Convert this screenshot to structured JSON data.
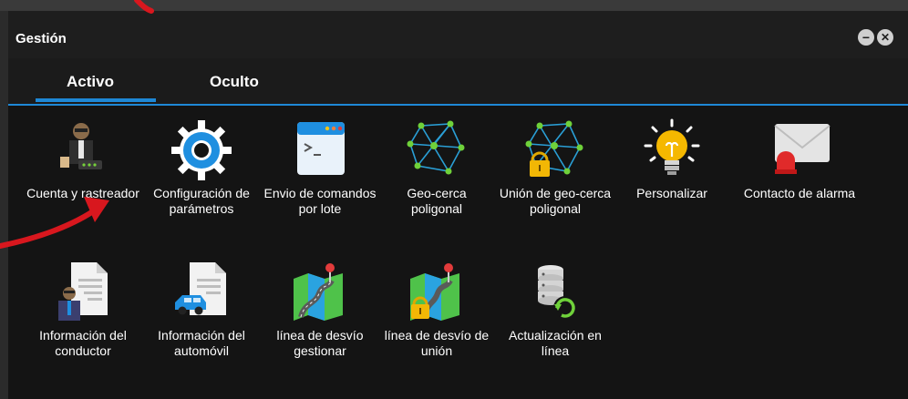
{
  "window": {
    "title": "Gestión"
  },
  "tabs": [
    {
      "label": "Activo"
    },
    {
      "label": "Oculto"
    }
  ],
  "items": [
    {
      "label": "Cuenta y rastreador",
      "icon": "account-tracker-icon"
    },
    {
      "label": "Configuración de parámetros",
      "icon": "settings-gear-icon"
    },
    {
      "label": "Envio de comandos por lote",
      "icon": "terminal-command-icon"
    },
    {
      "label": "Geo-cerca poligonal",
      "icon": "polygon-geofence-icon"
    },
    {
      "label": "Unión de geo-cerca poligonal",
      "icon": "locked-polygon-geofence-icon"
    },
    {
      "label": "Personalizar",
      "icon": "lightbulb-icon"
    },
    {
      "label": "Contacto de alarma",
      "icon": "alarm-mail-icon"
    },
    {
      "label": "Información del conductor",
      "icon": "driver-document-icon"
    },
    {
      "label": "Información del automóvil",
      "icon": "car-document-icon"
    },
    {
      "label": "línea de desvío gestionar",
      "icon": "route-map-icon"
    },
    {
      "label": "línea de desvío de unión",
      "icon": "locked-route-map-icon"
    },
    {
      "label": "Actualización en línea",
      "icon": "database-refresh-icon"
    }
  ],
  "colors": {
    "accent": "#1e88d6",
    "annotation": "#d8171e"
  }
}
